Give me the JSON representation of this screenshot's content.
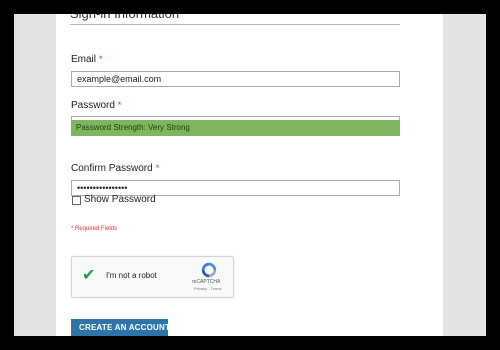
{
  "section": {
    "title": "Sign-in Information"
  },
  "email": {
    "label": "Email",
    "required_marker": "*",
    "value": "example@email.com"
  },
  "password": {
    "label": "Password",
    "required_marker": "*",
    "value": "••••••••••••••••",
    "strength_text": "Password Strength: Very Strong"
  },
  "confirm_password": {
    "label": "Confirm Password",
    "required_marker": "*",
    "value": "••••••••••••••••"
  },
  "show_password": {
    "label": "Show Password",
    "checked": false
  },
  "required_note": "* Required Fields",
  "captcha": {
    "label": "I'm not a robot",
    "brand": "reCAPTCHA",
    "terms": "Privacy - Terms",
    "checked": true
  },
  "actions": {
    "create_account_label": "CREATE AN ACCOUNT",
    "chevron": "›"
  },
  "colors": {
    "strength_bg": "#7db65d",
    "button_bg": "#2f74a8",
    "required": "#d33333",
    "check": "#1e9d4f"
  },
  "icons": {
    "captcha_logo": "recaptcha-logo-icon",
    "checkmark": "checkmark-icon",
    "button_chevron": "chevron-right-icon"
  }
}
